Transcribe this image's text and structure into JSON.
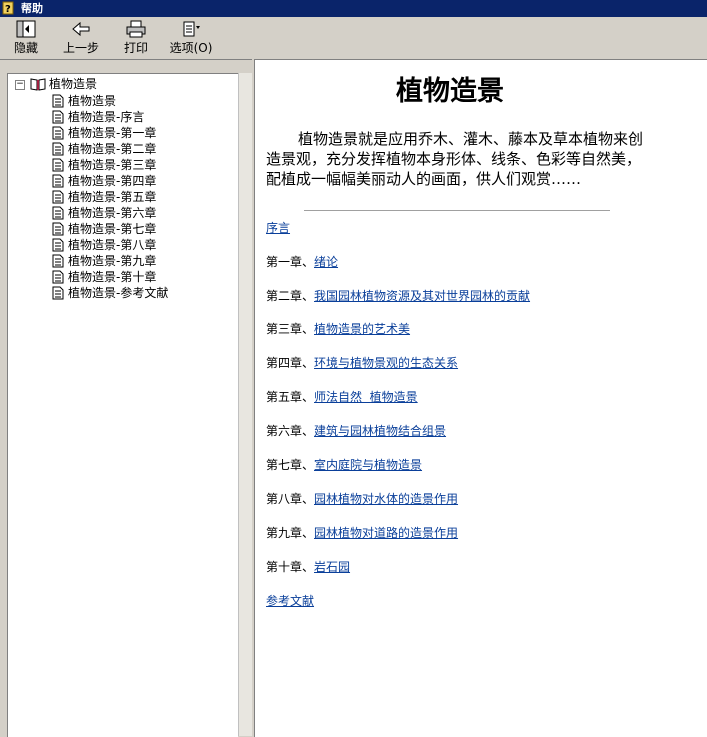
{
  "window": {
    "title": "帮助"
  },
  "toolbar": {
    "hide_label": "隐藏",
    "back_label": "上一步",
    "print_label": "打印",
    "options_label": "选项(O)"
  },
  "toc": {
    "root": "植物造景",
    "items": [
      "植物造景",
      "植物造景-序言",
      "植物造景-第一章",
      "植物造景-第二章",
      "植物造景-第三章",
      "植物造景-第四章",
      "植物造景-第五章",
      "植物造景-第六章",
      "植物造景-第七章",
      "植物造景-第八章",
      "植物造景-第九章",
      "植物造景-第十章",
      "植物造景-参考文献"
    ]
  },
  "content": {
    "title": "植物造景",
    "intro": "植物造景就是应用乔木、灌木、藤本及草本植物来创造景观，充分发挥植物本身形体、线条、色彩等自然美，配植成一幅幅美丽动人的画面，供人们观赏……",
    "preface_link": "序言",
    "chapters": [
      {
        "prefix": "第一章、",
        "link": "绪论"
      },
      {
        "prefix": "第二章、",
        "link": "我国园林植物资源及其对世界园林的贡献"
      },
      {
        "prefix": "第三章、",
        "link": "植物造景的艺术美"
      },
      {
        "prefix": "第四章、",
        "link": "环境与植物景观的生态关系"
      },
      {
        "prefix": "第五章、",
        "link": "师法自然  植物造景"
      },
      {
        "prefix": "第六章、",
        "link": "建筑与园林植物结合组景"
      },
      {
        "prefix": "第七章、",
        "link": "室内庭院与植物造景"
      },
      {
        "prefix": "第八章、",
        "link": "园林植物对水体的造景作用"
      },
      {
        "prefix": "第九章、",
        "link": "园林植物对道路的造景作用"
      },
      {
        "prefix": "第十章、",
        "link": "岩石园"
      }
    ],
    "references_link": "参考文献"
  },
  "colors": {
    "titlebar": "#0a246a",
    "link": "#0a3f9a",
    "chrome": "#d4d0c8"
  }
}
